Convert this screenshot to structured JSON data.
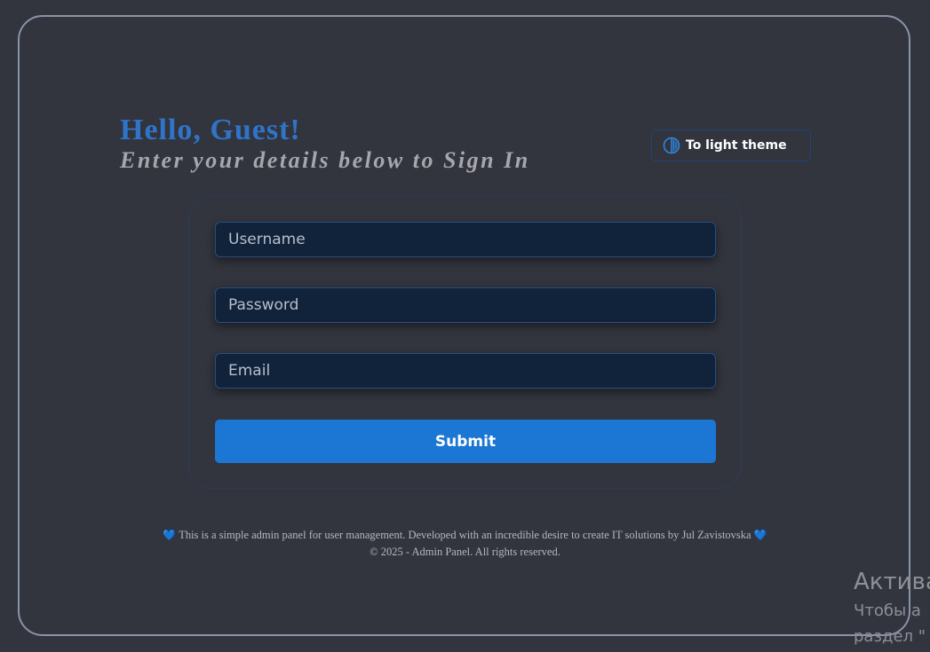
{
  "header": {
    "greeting": "Hello, Guest!",
    "subtitle": "Enter your details below to Sign In"
  },
  "theme_toggle": {
    "label": "To light theme",
    "icon": "half-circle-contrast-icon"
  },
  "form": {
    "username_placeholder": "Username",
    "password_placeholder": "Password",
    "email_placeholder": "Email",
    "submit_label": "Submit"
  },
  "footer": {
    "description": "This is a simple admin panel for user management. Developed with an incredible desire to create IT solutions by Jul Zavistovska",
    "heart": "💙",
    "copyright": "© 2025 - Admin Panel. All rights reserved."
  },
  "os_watermark": {
    "title": "Актива",
    "line1": "Чтобы а",
    "line2": "раздел \""
  },
  "colors": {
    "background": "#32343e",
    "accent": "#1c76d4",
    "greeting": "#2f74c8",
    "input_bg": "#11223b"
  }
}
